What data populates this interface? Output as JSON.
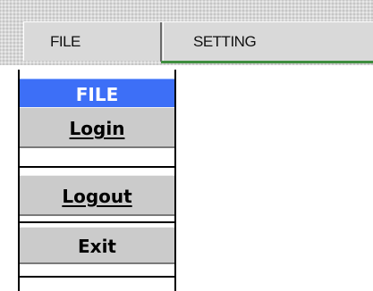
{
  "menubar": {
    "tabs": [
      {
        "label": "FILE"
      },
      {
        "label": "SETTING"
      }
    ]
  },
  "dropdown": {
    "header": "FILE",
    "items": [
      {
        "label": "Login"
      },
      {
        "label": "Logout"
      },
      {
        "label": "Exit"
      }
    ]
  },
  "colors": {
    "header_highlight": "#3d6ff7",
    "button_face": "#cbcbcb",
    "menubar_underline": "#3f8e3f"
  }
}
